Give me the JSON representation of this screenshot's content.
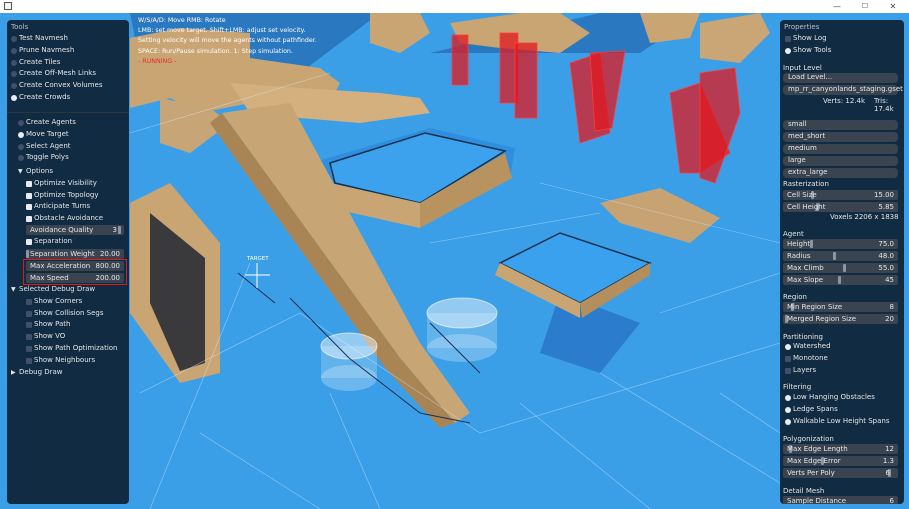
{
  "window": {
    "minimize": "—",
    "maximize": "☐",
    "close": "✕"
  },
  "help": {
    "line1": "W/S/A/D: Move  RMB: Rotate",
    "line2": "LMB: set move target.  Shift+LMB: adjust set velocity.",
    "line3": "Setting velocity will move the agents without pathfinder.",
    "line4": "SPACE: Run/Pause simulation.  1: Step simulation.",
    "line5": "- RUNNING -"
  },
  "viewport": {
    "target_label": "TARGET"
  },
  "tools": {
    "title": "Tools",
    "items": [
      {
        "label": "Test Navmesh",
        "selected": false
      },
      {
        "label": "Prune Navmesh",
        "selected": false
      },
      {
        "label": "Create Tiles",
        "selected": false
      },
      {
        "label": "Create Off-Mesh Links",
        "selected": false
      },
      {
        "label": "Create Convex Volumes",
        "selected": false
      },
      {
        "label": "Create Crowds",
        "selected": true
      }
    ],
    "modes": [
      {
        "label": "Create Agents",
        "selected": false
      },
      {
        "label": "Move Target",
        "selected": true
      },
      {
        "label": "Select Agent",
        "selected": false
      },
      {
        "label": "Toggle Polys",
        "selected": false
      }
    ],
    "options_label": "Options",
    "options": [
      {
        "label": "Optimize Visibility",
        "checked": true
      },
      {
        "label": "Optimize Topology",
        "checked": true
      },
      {
        "label": "Anticipate Turns",
        "checked": true
      },
      {
        "label": "Obstacle Avoidance",
        "checked": true
      }
    ],
    "avoidance_quality": {
      "label": "Avoidance Quality",
      "value": "3"
    },
    "separation": {
      "label": "Separation",
      "checked": true
    },
    "separation_weight": {
      "label": "Separation Weight",
      "value": "20.00"
    },
    "max_acceleration": {
      "label": "Max Acceleration",
      "value": "800.00"
    },
    "max_speed": {
      "label": "Max Speed",
      "value": "200.00"
    },
    "debug_label": "Selected Debug Draw",
    "debug_items": [
      {
        "label": "Show Corners",
        "checked": false
      },
      {
        "label": "Show Collision Segs",
        "checked": false
      },
      {
        "label": "Show Path",
        "checked": false
      },
      {
        "label": "Show VO",
        "checked": false
      },
      {
        "label": "Show Path Optimization",
        "checked": false
      },
      {
        "label": "Show Neighbours",
        "checked": false
      }
    ],
    "debug_draw_label": "Debug Draw"
  },
  "properties": {
    "title": "Properties",
    "show_log": "Show Log",
    "show_tools": "Show Tools",
    "input_level": "Input Level",
    "load_level": "Load Level...",
    "level_file": "mp_rr_canyonlands_staging.gset",
    "verts": "Verts: 12.4k",
    "tris": "Tris: 17.4k",
    "hull_buttons": [
      "small",
      "med_short",
      "medium",
      "large",
      "extra_large"
    ],
    "rasterization": "Rasterization",
    "cell_size": {
      "label": "Cell Size",
      "value": "15.00"
    },
    "cell_height": {
      "label": "Cell Height",
      "value": "5.85"
    },
    "voxels": "Voxels  2206 x 1838",
    "agent": "Agent",
    "height": {
      "label": "Height",
      "value": "75.0"
    },
    "radius": {
      "label": "Radius",
      "value": "48.0"
    },
    "max_climb": {
      "label": "Max Climb",
      "value": "55.0"
    },
    "max_slope": {
      "label": "Max Slope",
      "value": "45"
    },
    "region": "Region",
    "min_region_size": {
      "label": "Min Region Size",
      "value": "8"
    },
    "merged_region_size": {
      "label": "Merged Region Size",
      "value": "20"
    },
    "partitioning": "Partitioning",
    "partition_items": [
      {
        "label": "Watershed",
        "selected": true
      },
      {
        "label": "Monotone",
        "selected": false
      },
      {
        "label": "Layers",
        "selected": false
      }
    ],
    "filtering": "Filtering",
    "filter_items": [
      {
        "label": "Low Hanging Obstacles",
        "checked": true
      },
      {
        "label": "Ledge Spans",
        "checked": true
      },
      {
        "label": "Walkable Low Height Spans",
        "checked": true
      }
    ],
    "polygonization": "Polygonization",
    "max_edge_length": {
      "label": "Max Edge Length",
      "value": "12"
    },
    "max_edge_error": {
      "label": "Max Edge Error",
      "value": "1.3"
    },
    "verts_per_poly": {
      "label": "Verts Per Poly",
      "value": "6"
    },
    "detail_mesh": "Detail Mesh",
    "sample_distance": {
      "label": "Sample Distance",
      "value": "6"
    }
  }
}
